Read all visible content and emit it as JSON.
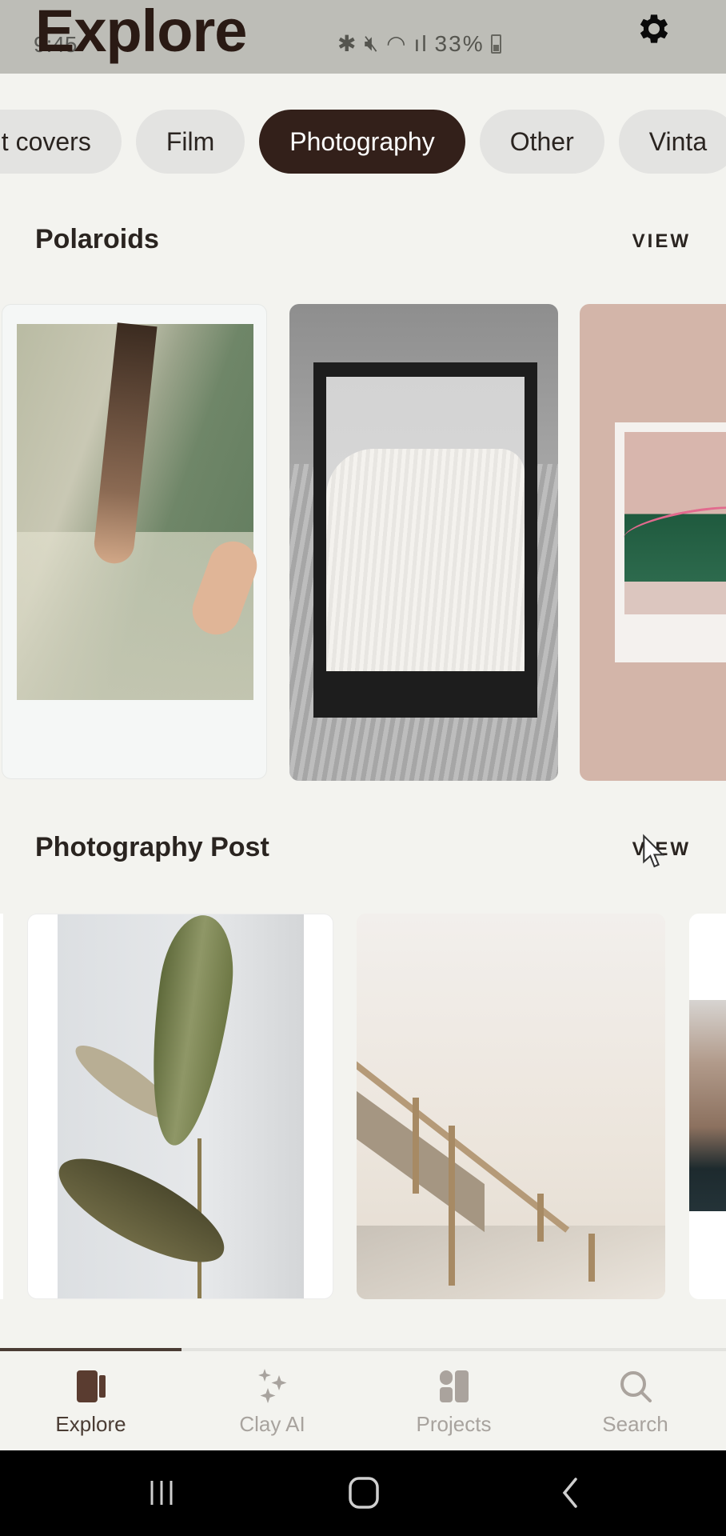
{
  "status_bar": {
    "time": "9:45",
    "battery": "33%",
    "icons": [
      "bluetooth-icon",
      "mute-icon",
      "wifi-icon",
      "signal-icon",
      "battery-icon"
    ]
  },
  "header": {
    "title": "Explore",
    "settings_icon": "gear-icon"
  },
  "chips": [
    {
      "label": "ht covers",
      "active": false
    },
    {
      "label": "Film",
      "active": false
    },
    {
      "label": "Photography",
      "active": true
    },
    {
      "label": "Other",
      "active": false
    },
    {
      "label": "Vinta",
      "active": false
    }
  ],
  "sections": [
    {
      "title": "Polaroids",
      "view_label": "VIEW",
      "cards": [
        "polaroid-hands",
        "polaroid-sweater-frame",
        "polaroid-pink-storefront"
      ]
    },
    {
      "title": "Photography Post",
      "view_label": "VIEW",
      "cards": [
        "post-leaf-plant",
        "post-beach-stairs",
        "post-coastal-rocks"
      ]
    }
  ],
  "scroll_progress_fraction": 0.25,
  "tabbar": {
    "items": [
      {
        "label": "Explore",
        "icon": "explore-icon",
        "active": true
      },
      {
        "label": "Clay AI",
        "icon": "sparkles-icon",
        "active": false
      },
      {
        "label": "Projects",
        "icon": "projects-icon",
        "active": false
      },
      {
        "label": "Search",
        "icon": "search-icon",
        "active": false
      }
    ]
  },
  "colors": {
    "accent": "#33201a",
    "chip_bg": "#e3e3e1",
    "tab_active": "#4a3c34",
    "tab_inactive": "#a8a39e",
    "background": "#f3f3ef"
  }
}
